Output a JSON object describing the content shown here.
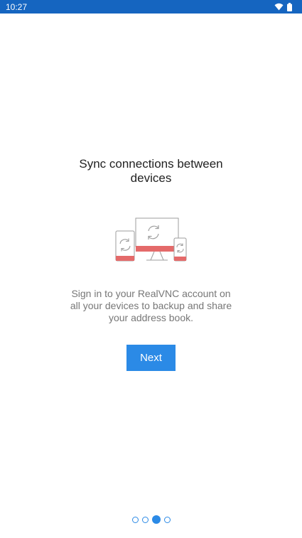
{
  "status_bar": {
    "time": "10:27",
    "icons": [
      "wifi-icon",
      "battery-icon"
    ]
  },
  "onboarding": {
    "title": "Sync connections between\ndevices",
    "illustration": "sync-devices-illustration",
    "description": "Sign in to your RealVNC account on\nall your devices to backup and share\nyour address book.",
    "next_label": "Next"
  },
  "page_indicator": {
    "total": 4,
    "current": 3
  },
  "colors": {
    "status_bar": "#1565c0",
    "accent": "#2b8ae6",
    "illustration_red": "#e46a6a",
    "illustration_gray": "#9e9e9e"
  }
}
